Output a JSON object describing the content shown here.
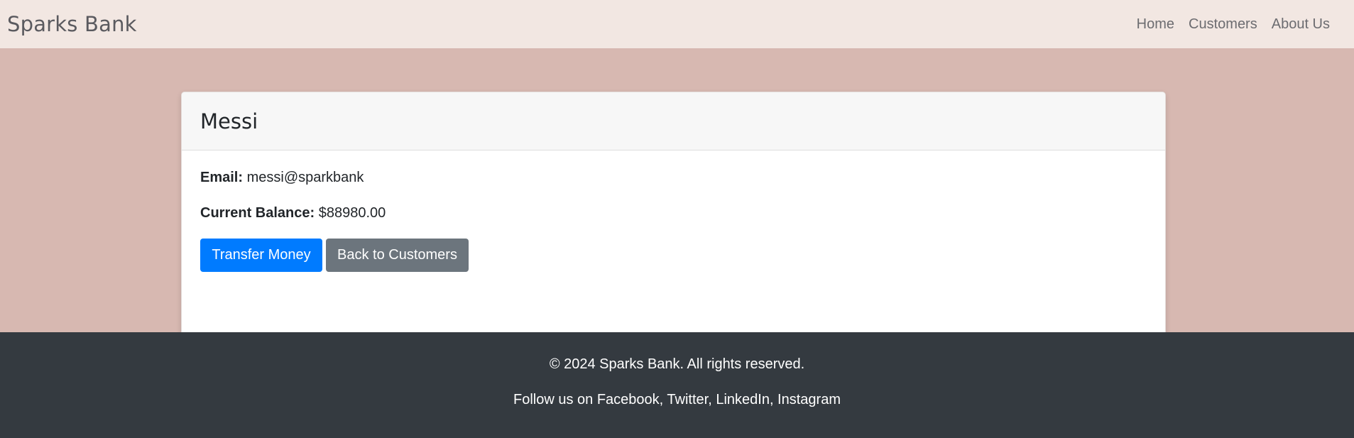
{
  "navbar": {
    "brand": "Sparks Bank",
    "links": [
      "Home",
      "Customers",
      "About Us"
    ]
  },
  "customer": {
    "name": "Messi",
    "email_label": "Email:",
    "email": "messi@sparkbank",
    "balance_label": "Current Balance:",
    "balance": "$88980.00"
  },
  "actions": {
    "transfer_label": "Transfer Money",
    "back_label": "Back to Customers"
  },
  "footer": {
    "copyright": "© 2024 Sparks Bank. All rights reserved.",
    "follow": "Follow us on Facebook, Twitter, LinkedIn, Instagram"
  },
  "colors": {
    "page_bg": "#d7b8b1",
    "navbar_bg": "#f2e7e2",
    "primary": "#007bff",
    "secondary": "#6c757d",
    "footer_bg": "#343a40"
  }
}
